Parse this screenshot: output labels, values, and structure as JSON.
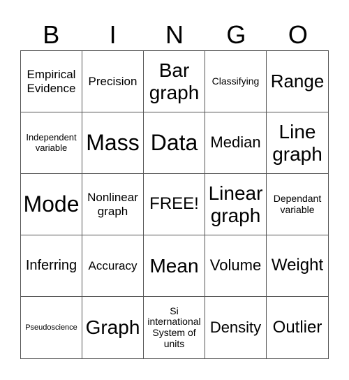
{
  "header": [
    "B",
    "I",
    "N",
    "G",
    "O"
  ],
  "cells": [
    "Empirical Evidence",
    "Precision",
    "Bar graph",
    "Classifying",
    "Range",
    "Independent variable",
    "Mass",
    "Data",
    "Median",
    "Line graph",
    "Mode",
    "Nonlinear graph",
    "FREE!",
    "Linear graph",
    "Dependant variable",
    "Inferring",
    "Accuracy",
    "Mean",
    "Volume",
    "Weight",
    "Pseudoscience",
    "Graph",
    "Si international System of units",
    "Density",
    "Outlier"
  ]
}
